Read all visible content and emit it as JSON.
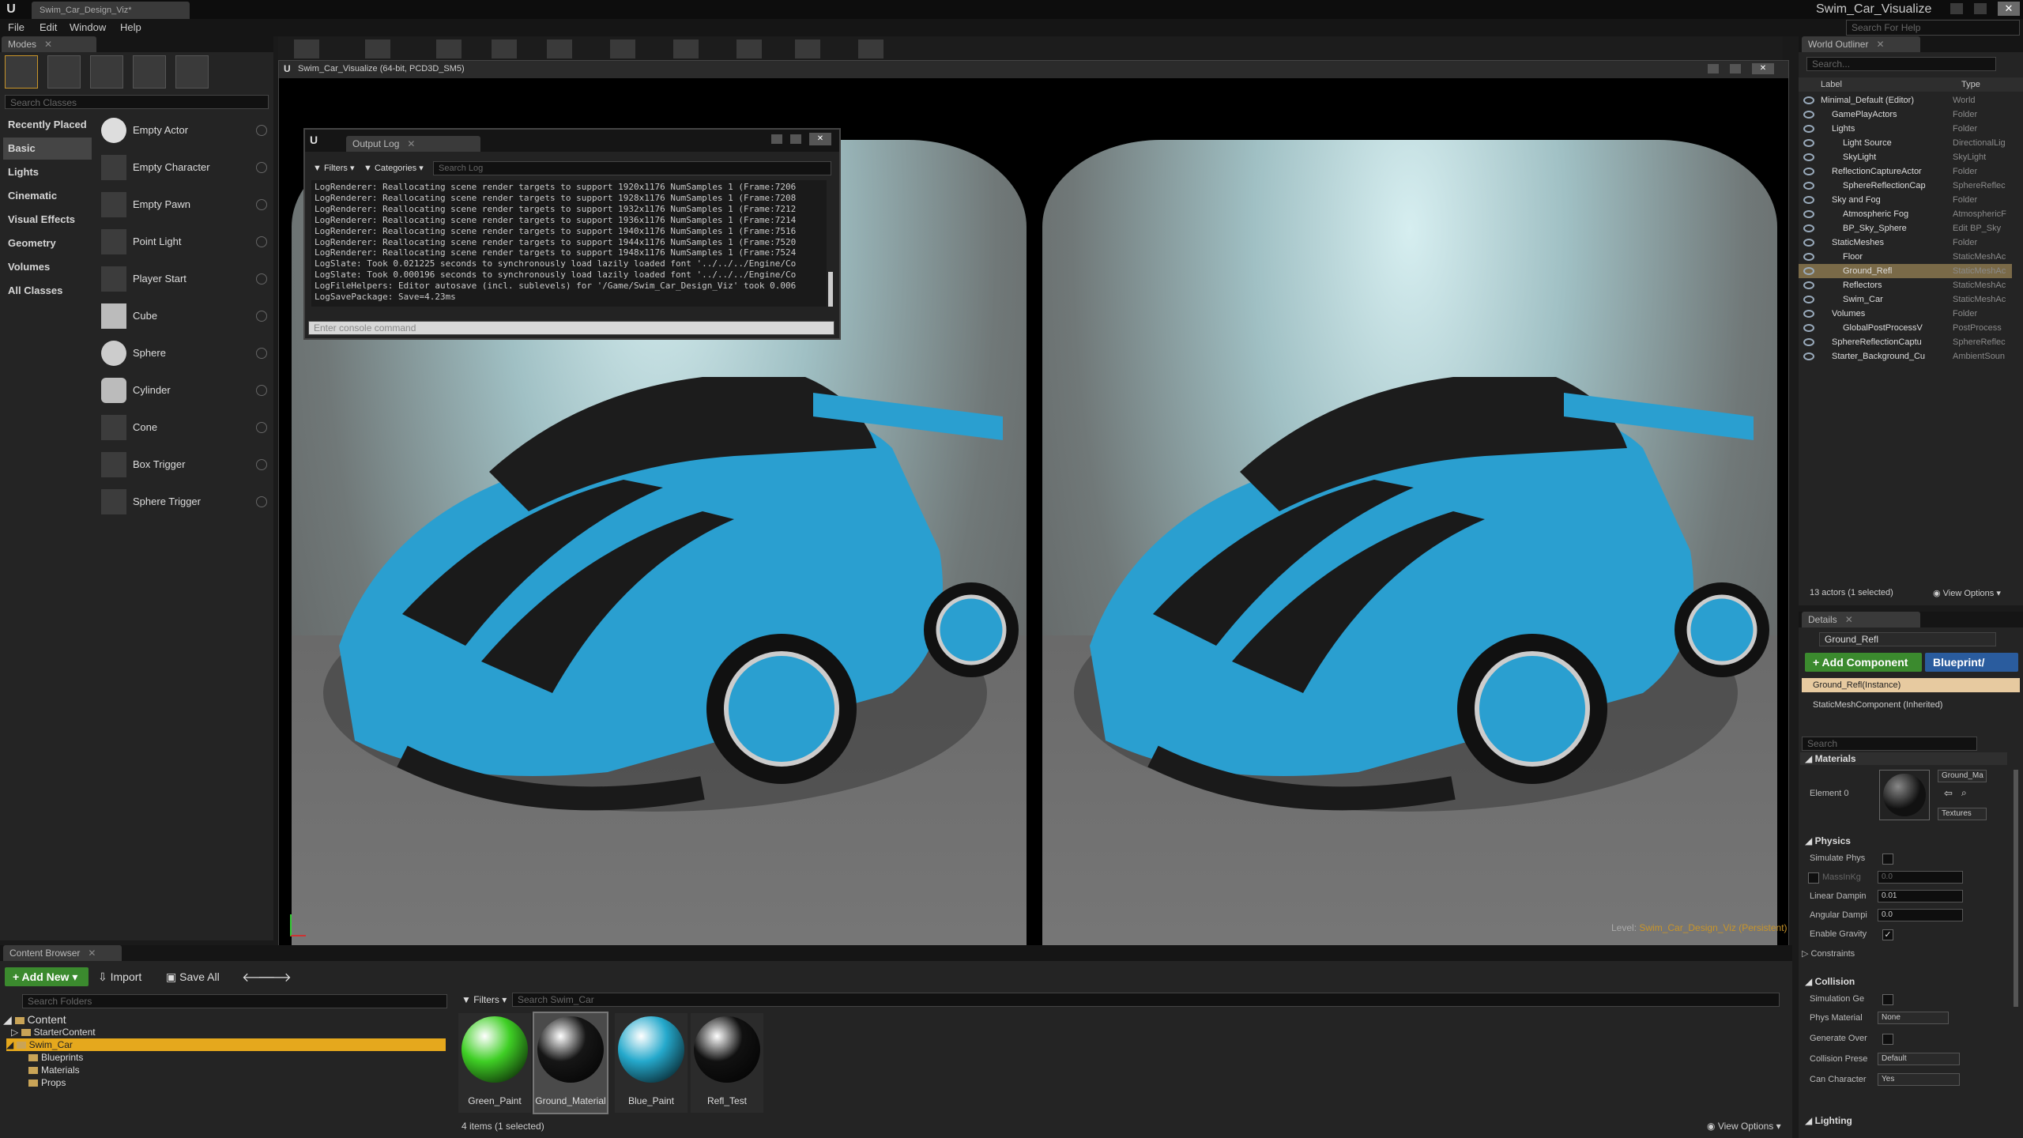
{
  "titlebar": {
    "project_tab": "Swim_Car_Design_Viz*",
    "app_title": "Swim_Car_Visualize",
    "search_help_placeholder": "Search For Help"
  },
  "menu": {
    "items": [
      "File",
      "Edit",
      "Window",
      "Help"
    ]
  },
  "modes": {
    "tab_label": "Modes",
    "search_placeholder": "Search Classes",
    "categories": [
      "Recently Placed",
      "Basic",
      "Lights",
      "Cinematic",
      "Visual Effects",
      "Geometry",
      "Volumes",
      "All Classes"
    ],
    "selected_category": "Basic",
    "items": [
      "Empty Actor",
      "Empty Character",
      "Empty Pawn",
      "Point Light",
      "Player Start",
      "Cube",
      "Sphere",
      "Cylinder",
      "Cone",
      "Box Trigger",
      "Sphere Trigger"
    ]
  },
  "viewport": {
    "window_title": "Swim_Car_Visualize (64-bit, PCD3D_SM5)",
    "level_prefix": "Level:",
    "level_name": "Swim_Car_Design_Viz (Persistent)"
  },
  "output_log": {
    "tab_label": "Output Log",
    "filters_label": "Filters",
    "categories_label": "Categories",
    "search_placeholder": "Search Log",
    "console_placeholder": "Enter console command",
    "lines": [
      "LogRenderer: Reallocating scene render targets to support 1920x1176 NumSamples 1 (Frame:7206",
      "LogRenderer: Reallocating scene render targets to support 1928x1176 NumSamples 1 (Frame:7208",
      "LogRenderer: Reallocating scene render targets to support 1932x1176 NumSamples 1 (Frame:7212",
      "LogRenderer: Reallocating scene render targets to support 1936x1176 NumSamples 1 (Frame:7214",
      "LogRenderer: Reallocating scene render targets to support 1940x1176 NumSamples 1 (Frame:7516",
      "LogRenderer: Reallocating scene render targets to support 1944x1176 NumSamples 1 (Frame:7520",
      "LogRenderer: Reallocating scene render targets to support 1948x1176 NumSamples 1 (Frame:7524",
      "LogSlate: Took 0.021225 seconds to synchronously load lazily loaded font '../../../Engine/Co",
      "LogSlate: Took 0.000196 seconds to synchronously load lazily loaded font '../../../Engine/Co",
      "LogFileHelpers: Editor autosave (incl. sublevels) for '/Game/Swim_Car_Design_Viz' took 0.006",
      "LogSavePackage: Save=4.23ms"
    ]
  },
  "outliner": {
    "tab_label": "World Outliner",
    "search_placeholder": "Search...",
    "col_label": "Label",
    "col_type": "Type",
    "rows": [
      {
        "label": "Minimal_Default (Editor)",
        "type": "World",
        "indent": 0
      },
      {
        "label": "GamePlayActors",
        "type": "Folder",
        "indent": 1
      },
      {
        "label": "Lights",
        "type": "Folder",
        "indent": 1
      },
      {
        "label": "Light Source",
        "type": "DirectionalLig",
        "indent": 2
      },
      {
        "label": "SkyLight",
        "type": "SkyLight",
        "indent": 2
      },
      {
        "label": "ReflectionCaptureActor",
        "type": "Folder",
        "indent": 1
      },
      {
        "label": "SphereReflectionCap",
        "type": "SphereReflec",
        "indent": 2
      },
      {
        "label": "Sky and Fog",
        "type": "Folder",
        "indent": 1
      },
      {
        "label": "Atmospheric Fog",
        "type": "AtmosphericF",
        "indent": 2
      },
      {
        "label": "BP_Sky_Sphere",
        "type": "Edit BP_Sky",
        "indent": 2
      },
      {
        "label": "StaticMeshes",
        "type": "Folder",
        "indent": 1
      },
      {
        "label": "Floor",
        "type": "StaticMeshAc",
        "indent": 2
      },
      {
        "label": "Ground_Refl",
        "type": "StaticMeshAc",
        "indent": 2
      },
      {
        "label": "Reflectors",
        "type": "StaticMeshAc",
        "indent": 2
      },
      {
        "label": "Swim_Car",
        "type": "StaticMeshAc",
        "indent": 2
      },
      {
        "label": "Volumes",
        "type": "Folder",
        "indent": 1
      },
      {
        "label": "GlobalPostProcessV",
        "type": "PostProcess",
        "indent": 2
      },
      {
        "label": "SphereReflectionCaptu",
        "type": "SphereReflec",
        "indent": 1
      },
      {
        "label": "Starter_Background_Cu",
        "type": "AmbientSoun",
        "indent": 1
      }
    ],
    "selected_index": 12,
    "status": "13 actors (1 selected)",
    "view_options": "View Options"
  },
  "details": {
    "tab_label": "Details",
    "name_value": "Ground_Refl",
    "add_component": "+ Add Component",
    "blueprint": "Blueprint/",
    "instance_row": "Ground_Refl(Instance)",
    "component_row": "StaticMeshComponent (Inherited)",
    "search_placeholder": "Search",
    "materials_header": "Materials",
    "element_label": "Element 0",
    "material_value": "Ground_Ma",
    "textures_label": "Textures",
    "physics_header": "Physics",
    "simulate_phys": "Simulate Phys",
    "mass_label": "MassInKg",
    "mass_value": "0.0",
    "linear_damping": "Linear Dampin",
    "linear_value": "0.01",
    "angular_damping": "Angular Dampi",
    "angular_value": "0.0",
    "enable_gravity": "Enable Gravity",
    "constraints": "Constraints",
    "collision_header": "Collision",
    "sim_gen": "Simulation Ge",
    "phys_material": "Phys Material",
    "phys_material_value": "None",
    "generate_over": "Generate Over",
    "collision_preset": "Collision Prese",
    "collision_preset_value": "Default",
    "can_character": "Can Character",
    "can_character_value": "Yes",
    "lighting_header": "Lighting"
  },
  "content_browser": {
    "tab_label": "Content Browser",
    "add_new": "Add New",
    "import": "Import",
    "save_all": "Save All",
    "search_folders": "Search Folders",
    "filters_label": "Filters",
    "search_assets": "Search Swim_Car",
    "tree": [
      {
        "label": "Content",
        "indent": 0
      },
      {
        "label": "StarterContent",
        "indent": 1
      },
      {
        "label": "Swim_Car",
        "indent": 1
      },
      {
        "label": "Blueprints",
        "indent": 2
      },
      {
        "label": "Materials",
        "indent": 2
      },
      {
        "label": "Props",
        "indent": 2
      }
    ],
    "selected_tree": "Swim_Car",
    "assets": [
      {
        "name": "Green_Paint",
        "color": "#3fcf25"
      },
      {
        "name": "Ground_Material",
        "color": "#161616"
      },
      {
        "name": "Blue_Paint",
        "color": "#25a9cc"
      },
      {
        "name": "Refl_Test",
        "color": "#111111"
      }
    ],
    "status": "4 items (1 selected)",
    "view_options": "View Options"
  },
  "colors": {
    "accent_orange": "#c9952a",
    "car_blue": "#2a9fd0",
    "editor_bg": "#242424"
  }
}
